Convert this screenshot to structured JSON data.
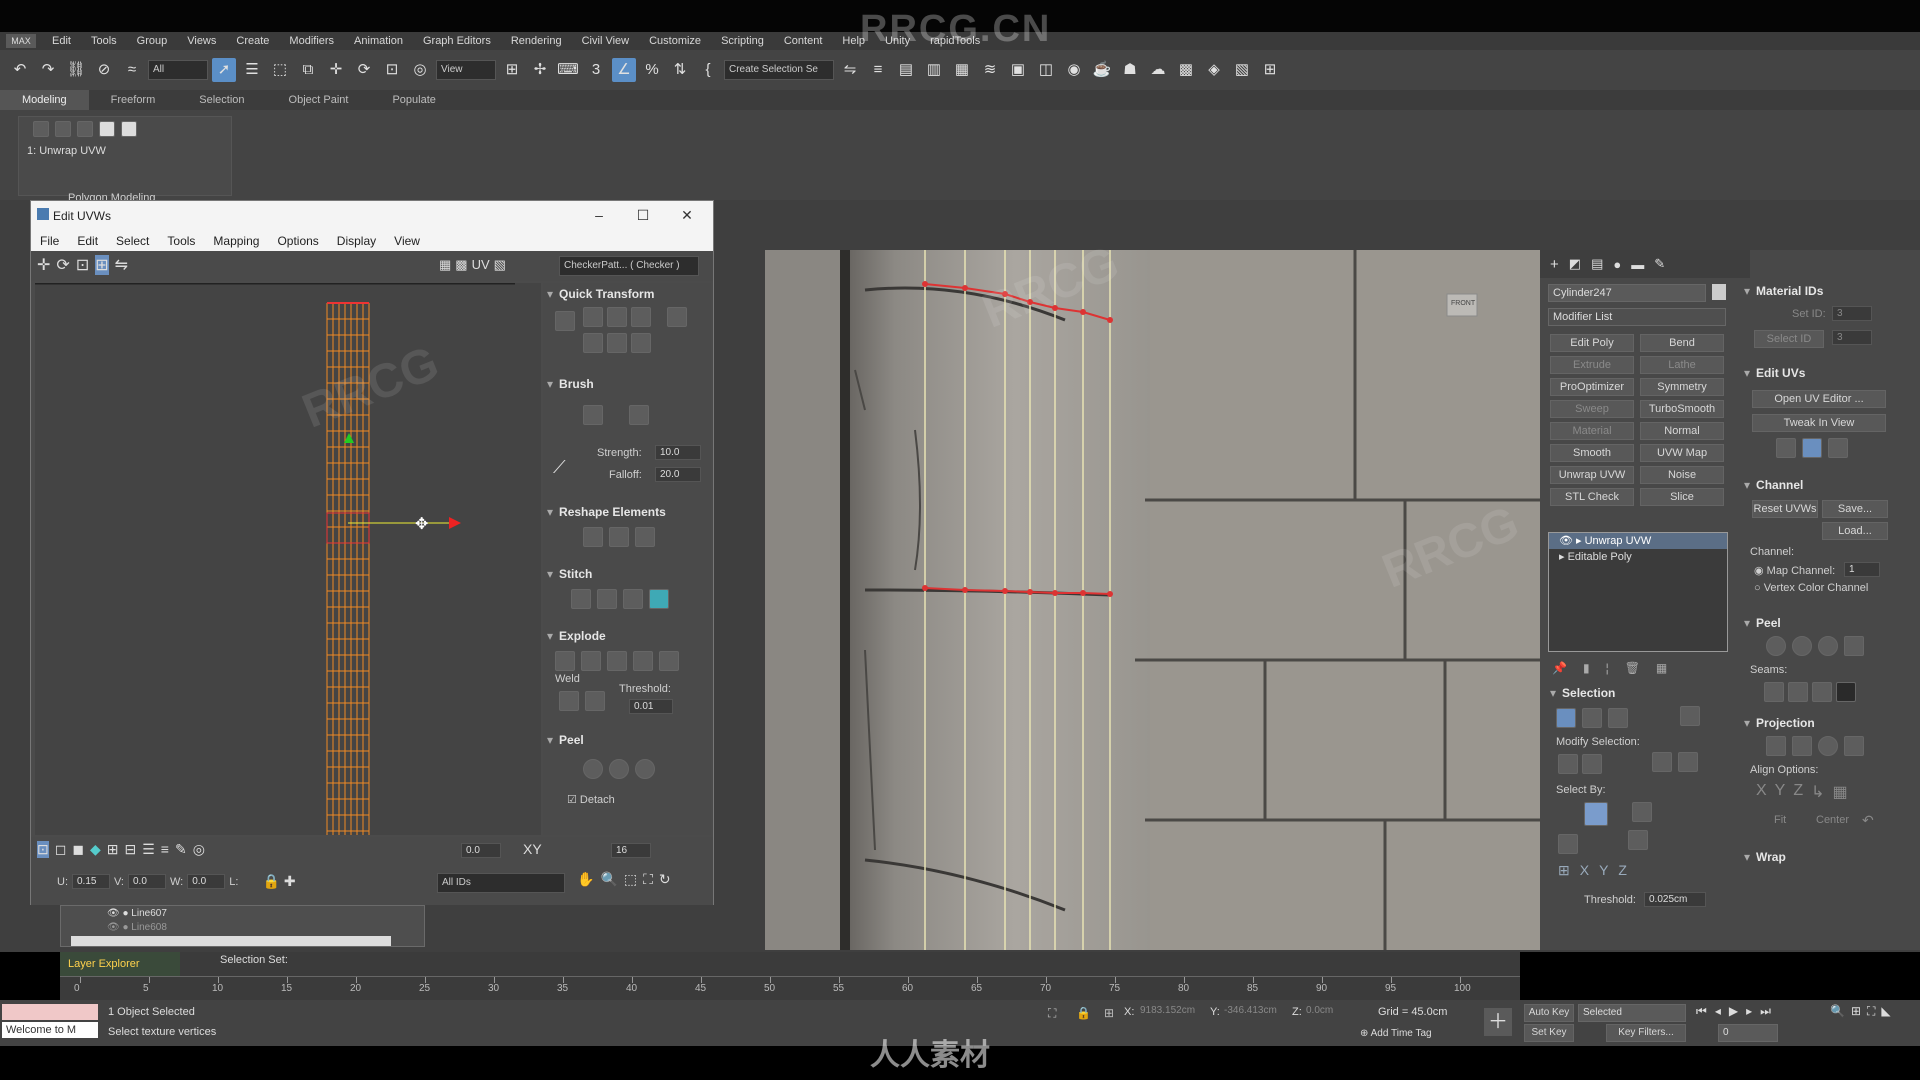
{
  "watermark": {
    "top": "RRCG.CN",
    "bottom": "人人素材",
    "tile": "RRCG"
  },
  "app": {
    "logo": "MAX",
    "menu": [
      "Edit",
      "Tools",
      "Group",
      "Views",
      "Create",
      "Modifiers",
      "Animation",
      "Graph Editors",
      "Rendering",
      "Civil View",
      "Customize",
      "Scripting",
      "Content",
      "Help",
      "Unity",
      "rapidTools"
    ]
  },
  "toolbar": {
    "filter_select": "All",
    "view_select": "View",
    "selection_set": "Create Selection Se"
  },
  "ribbon": {
    "tabs": [
      "Modeling",
      "Freeform",
      "Selection",
      "Object Paint",
      "Populate"
    ],
    "modifier_label": "1: Unwrap UVW",
    "panel_label": "Polygon Modeling"
  },
  "uv_editor": {
    "title": "Edit UVWs",
    "menu": [
      "File",
      "Edit",
      "Select",
      "Tools",
      "Mapping",
      "Options",
      "Display",
      "View"
    ],
    "uv_label": "UV",
    "checker": "CheckerPatt... ( Checker )",
    "sections": {
      "quick_transform": "Quick Transform",
      "brush": "Brush",
      "strength_label": "Strength:",
      "strength_value": "10.0",
      "falloff_label": "Falloff:",
      "falloff_value": "20.0",
      "reshape": "Reshape Elements",
      "stitch": "Stitch",
      "explode": "Explode",
      "weld_label": "Weld",
      "threshold_label": "Threshold:",
      "threshold_value": "0.01",
      "peel": "Peel",
      "detach_label": "Detach"
    },
    "bottom": {
      "angle_value": "0.0",
      "xy_label": "XY",
      "pixel_value": "16",
      "u_label": "U:",
      "u_value": "0.15",
      "v_label": "V:",
      "v_value": "0.0",
      "w_label": "W:",
      "w_value": "0.0",
      "l_label": "L:",
      "ids_select": "All IDs"
    }
  },
  "scene_explorer": {
    "rows": [
      "Line607",
      "Line608"
    ],
    "title": "Layer Explorer",
    "selection_set": "Selection Set:"
  },
  "viewport": {
    "label": "FRONT"
  },
  "command_panel": {
    "object_name": "Cylinder247",
    "modifier_list": "Modifier List",
    "buttons": [
      {
        "label": "Edit Poly",
        "dim": false
      },
      {
        "label": "Bend",
        "dim": false
      },
      {
        "label": "Extrude",
        "dim": true
      },
      {
        "label": "Lathe",
        "dim": true
      },
      {
        "label": "ProOptimizer",
        "dim": false
      },
      {
        "label": "Symmetry",
        "dim": false
      },
      {
        "label": "Sweep",
        "dim": true
      },
      {
        "label": "TurboSmooth",
        "dim": false
      },
      {
        "label": "Material",
        "dim": true
      },
      {
        "label": "Normal",
        "dim": false
      },
      {
        "label": "Smooth",
        "dim": false
      },
      {
        "label": "UVW Map",
        "dim": false
      },
      {
        "label": "Unwrap UVW",
        "dim": false
      },
      {
        "label": "Noise",
        "dim": false
      },
      {
        "label": "STL Check",
        "dim": false
      },
      {
        "label": "Slice",
        "dim": false
      }
    ],
    "stack": [
      "Unwrap UVW",
      "Editable Poly"
    ],
    "selection": {
      "header": "Selection",
      "modify_selection": "Modify Selection:",
      "select_by": "Select By:",
      "threshold_label": "Threshold:",
      "threshold_value": "0.025cm"
    },
    "material_ids": {
      "header": "Material IDs",
      "set_id": "Set ID:",
      "set_id_value": "3",
      "select_id": "Select ID",
      "select_id_value": "3"
    },
    "edit_uvs": {
      "header": "Edit UVs",
      "open_editor": "Open UV Editor ...",
      "tweak": "Tweak In View"
    },
    "channel": {
      "header": "Channel",
      "reset": "Reset UVWs",
      "save": "Save...",
      "load": "Load...",
      "channel_label": "Channel:",
      "map_channel": "Map Channel:",
      "map_value": "1",
      "vertex_color": "Vertex Color Channel"
    },
    "peel": {
      "header": "Peel",
      "seams": "Seams:"
    },
    "projection": {
      "header": "Projection",
      "align": "Align Options:",
      "fit": "Fit",
      "center": "Center"
    },
    "wrap": {
      "header": "Wrap"
    }
  },
  "timeline": {
    "ticks": [
      "0",
      "5",
      "10",
      "15",
      "20",
      "25",
      "30",
      "35",
      "40",
      "45",
      "50",
      "55",
      "60",
      "65",
      "70",
      "75",
      "80",
      "85",
      "90",
      "95",
      "100"
    ]
  },
  "status": {
    "maxscript": "Welcome to M",
    "objects": "1 Object Selected",
    "prompt": "Select texture vertices",
    "x_label": "X:",
    "x_value": "9183.152cm",
    "y_label": "Y:",
    "y_value": "-346.413cm",
    "z_label": "Z:",
    "z_value": "0.0cm",
    "grid": "Grid = 45.0cm",
    "add_time_tag": "Add Time Tag",
    "auto_key": "Auto Key",
    "selected": "Selected",
    "set_key": "Set Key",
    "key_filters": "Key Filters...",
    "frame": "0"
  }
}
